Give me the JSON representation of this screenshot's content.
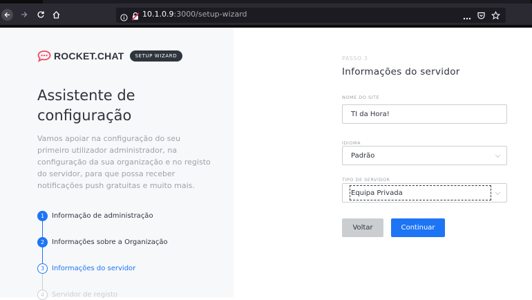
{
  "browser": {
    "url_host": "10.1.0.9",
    "url_path": ":3000/setup-wizard",
    "icons": [
      "back-icon",
      "forward-icon",
      "reload-icon",
      "home-icon",
      "info-icon",
      "insecure-lock-icon",
      "more-icon",
      "pocket-icon",
      "bookmark-star-icon"
    ]
  },
  "brand": {
    "name": "ROCKET.CHAT",
    "badge": "SETUP WIZARD",
    "logo_color": "#f5455c"
  },
  "left": {
    "title": "Assistente de configuração",
    "intro": "Vamos apoiar na configuração do seu primeiro utilizador administrador, na configuração da sua organização e no registo do servidor, para que possa receber notificações push gratuitas e muito mais.",
    "steps": [
      {
        "num": "1",
        "label": "Informação de administração",
        "state": "done"
      },
      {
        "num": "2",
        "label": "Informações sobre a Organização",
        "state": "done"
      },
      {
        "num": "3",
        "label": "Informações do servidor",
        "state": "current"
      },
      {
        "num": "4",
        "label": "Servidor de registo",
        "state": "future"
      }
    ]
  },
  "form": {
    "step_label": "PASSO 3",
    "title": "Informações do servidor",
    "site_name": {
      "label": "NOME DO SITE",
      "value": "TI da Hora!"
    },
    "language": {
      "label": "IDIOMA",
      "value": "Padrão"
    },
    "server_type": {
      "label": "TIPO DE SERVIDOR",
      "value": "Equipa Privada"
    },
    "back_label": "Voltar",
    "next_label": "Continuar"
  },
  "colors": {
    "accent": "#1d74f5",
    "text_dark": "#2f343d",
    "muted": "#9ea2a8",
    "border": "#cbced1"
  }
}
